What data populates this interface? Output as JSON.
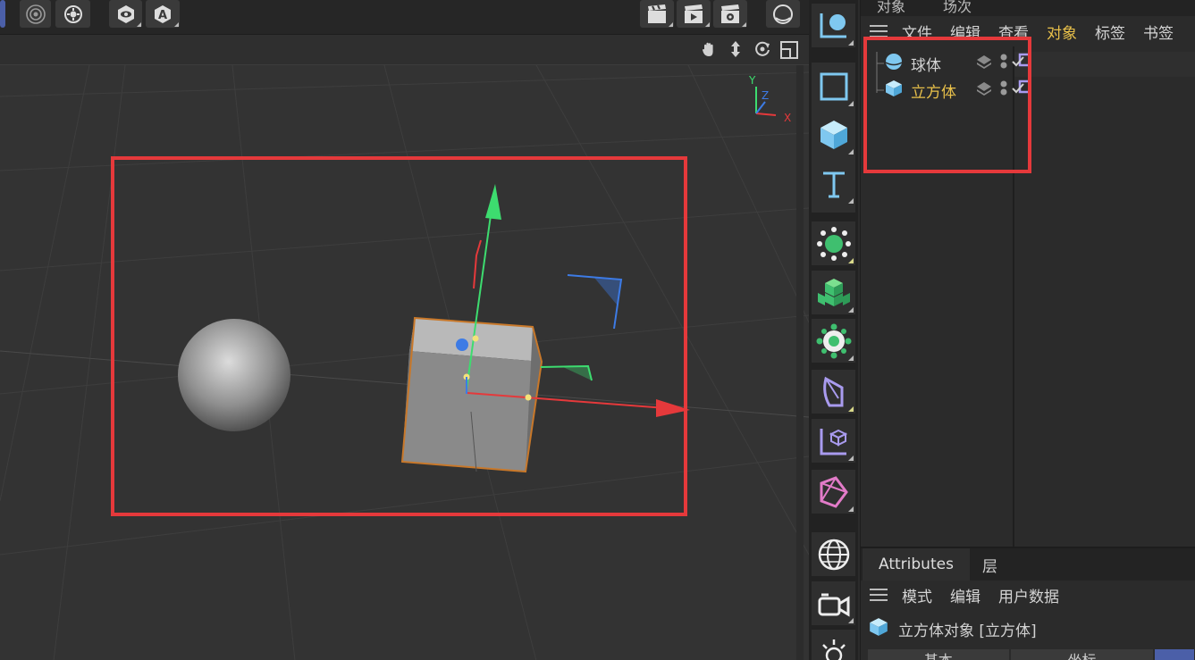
{
  "object_manager": {
    "tabs": [
      "对象",
      "场次"
    ],
    "menu": [
      "文件",
      "编辑",
      "查看",
      "对象",
      "标签",
      "书签"
    ],
    "active_menu": "对象",
    "objects": [
      {
        "name": "球体",
        "icon": "sphere-icon",
        "selected": false
      },
      {
        "name": "立方体",
        "icon": "cube-icon",
        "selected": true
      }
    ]
  },
  "attributes": {
    "tabs": [
      "Attributes",
      "层"
    ],
    "menu": [
      "模式",
      "编辑",
      "用户数据"
    ],
    "title": "立方体对象 [立方体]",
    "subtabs": [
      "基本",
      "坐标"
    ]
  },
  "viewport": {
    "axis_labels": {
      "x": "X",
      "y": "Y",
      "z": "Z"
    }
  },
  "colors": {
    "accent": "#e8c04a",
    "highlight_box": "#e5393b",
    "x_axis": "#e5393b",
    "y_axis": "#3ddc6f",
    "z_axis": "#3d7be5",
    "selection": "#c8782a",
    "icon_blue": "#7fc8f0",
    "icon_green": "#3fbf6f",
    "icon_purple": "#a99bef"
  },
  "palette_icons": [
    "null-object-icon",
    "rectangle-spline-icon",
    "cube-primitive-icon",
    "text-icon",
    "cloner-icon",
    "mograph-cube-icon",
    "effector-icon",
    "deformer-icon",
    "coordinate-cube-icon",
    "bend-icon",
    "sky-globe-icon",
    "camera-icon",
    "light-icon"
  ],
  "top_icons": [
    "render-target-icon",
    "settings-gear-icon",
    "view-eye-icon",
    "attribute-a-icon",
    "clapper-icon",
    "render-play-icon",
    "render-settings-icon",
    "sphere-nav-icon"
  ],
  "viewport_nav_icons": [
    "pan-hand-icon",
    "move-arrows-icon",
    "rotate-icon",
    "maximize-icon"
  ]
}
